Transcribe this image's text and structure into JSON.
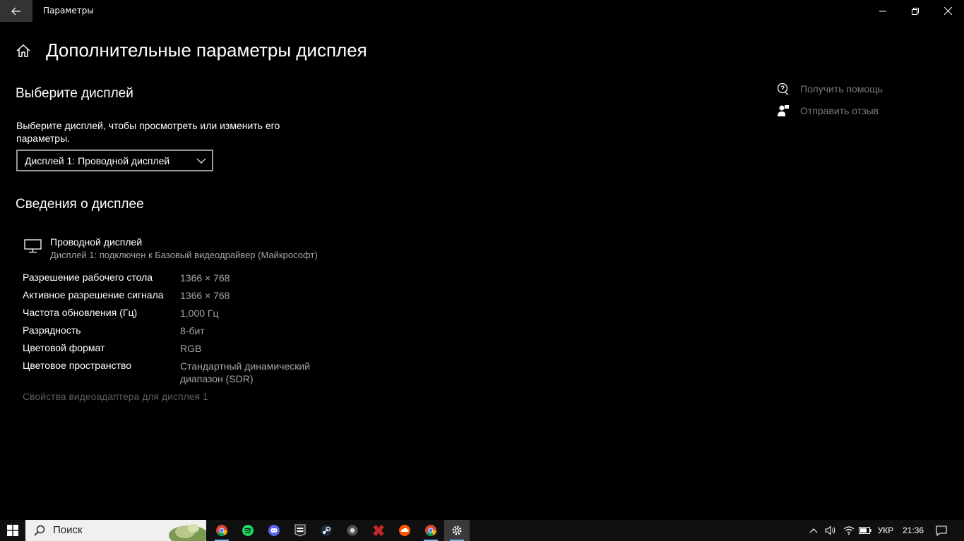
{
  "window": {
    "title": "Параметры"
  },
  "page": {
    "title": "Дополнительные параметры дисплея"
  },
  "select_display": {
    "heading": "Выберите дисплей",
    "description": "Выберите дисплей, чтобы просмотреть или изменить его параметры.",
    "dropdown_value": "Дисплей 1: Проводной дисплей"
  },
  "display_info": {
    "heading": "Сведения о дисплее",
    "name": "Проводной дисплей",
    "subtitle": "Дисплей 1: подключен к Базовый видеодрайвер (Майкрософт)",
    "rows": [
      {
        "label": "Разрешение рабочего стола",
        "value": "1366 × 768"
      },
      {
        "label": "Активное разрешение сигнала",
        "value": "1366 × 768"
      },
      {
        "label": "Частота обновления (Гц)",
        "value": "1,000 Гц"
      },
      {
        "label": "Разрядность",
        "value": "8-бит"
      },
      {
        "label": "Цветовой формат",
        "value": "RGB"
      },
      {
        "label": "Цветовое пространство",
        "value": "Стандартный динамический диапазон (SDR)"
      }
    ],
    "adapter_link": "Свойства видеоадаптера для дисплея 1"
  },
  "help": {
    "get_help": "Получить помощь",
    "send_feedback": "Отправить отзыв"
  },
  "taskbar": {
    "search_placeholder": "Поиск",
    "apps": [
      "chrome-icon",
      "spotify-icon",
      "discord-icon",
      "epic-games-icon",
      "steam-icon",
      "obs-icon",
      "app-icon",
      "soundcloud-icon",
      "chrome-icon",
      "settings-icon"
    ],
    "language": "УКР",
    "time": "21:36"
  },
  "colors": {
    "background": "#000000",
    "accent": "#76b9ed",
    "secondary_text": "#a6a6a6",
    "disabled_text": "#5c5c5c"
  }
}
